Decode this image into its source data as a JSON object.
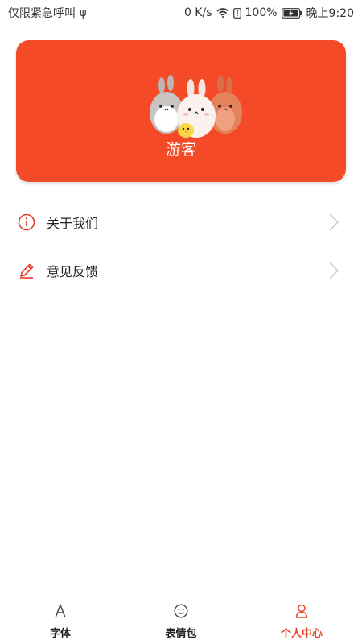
{
  "status_bar": {
    "left_text": "仅限紧急呼叫",
    "net_speed": "0 K/s",
    "battery": "100%",
    "time": "晚上9:20"
  },
  "profile": {
    "username": "游客"
  },
  "menu": {
    "items": [
      {
        "label": "关于我们",
        "icon": "info-icon"
      },
      {
        "label": "意见反馈",
        "icon": "pencil-icon"
      }
    ]
  },
  "bottom_nav": {
    "active": "个人中心",
    "items": [
      {
        "label": "字体",
        "icon": "letter-a-icon"
      },
      {
        "label": "表情包",
        "icon": "smiley-icon"
      },
      {
        "label": "个人中心",
        "icon": "user-icon"
      }
    ]
  },
  "colors": {
    "accent": "#f54a27",
    "active_tab": "#e8432a"
  }
}
